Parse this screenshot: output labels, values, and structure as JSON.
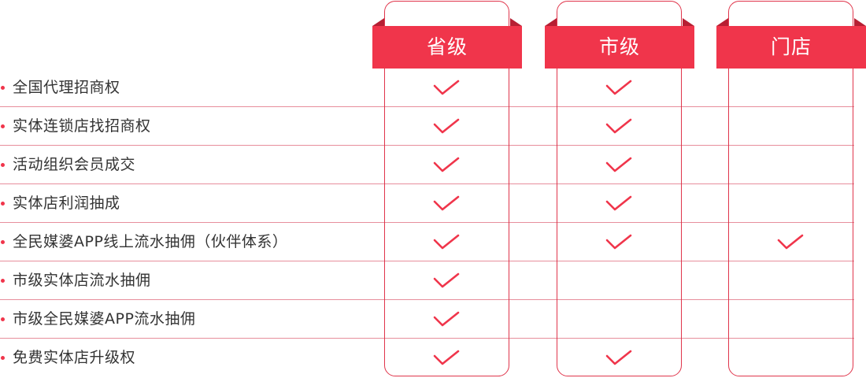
{
  "columns": [
    {
      "label": "省级",
      "icon": "check-icon"
    },
    {
      "label": "市级",
      "icon": "check-icon"
    },
    {
      "label": "门店",
      "icon": "check-icon"
    }
  ],
  "rows": [
    {
      "label": "全国代理招商权",
      "checks": [
        true,
        true,
        false
      ]
    },
    {
      "label": "实体连锁店找招商权",
      "checks": [
        true,
        true,
        false
      ]
    },
    {
      "label": "活动组织会员成交",
      "checks": [
        true,
        true,
        false
      ]
    },
    {
      "label": "实体店利润抽成",
      "checks": [
        true,
        true,
        false
      ]
    },
    {
      "label": "全民媒婆APP线上流水抽佣（伙伴体系）",
      "checks": [
        true,
        true,
        true
      ]
    },
    {
      "label": "市级实体店流水抽佣",
      "checks": [
        true,
        false,
        false
      ]
    },
    {
      "label": "市级全民媒婆APP流水抽佣",
      "checks": [
        true,
        false,
        false
      ]
    },
    {
      "label": "免费实体店升级权",
      "checks": [
        true,
        true,
        false
      ]
    }
  ],
  "colors": {
    "accent": "#f0354b",
    "accent_dark": "#b71f33",
    "text": "#333333"
  }
}
